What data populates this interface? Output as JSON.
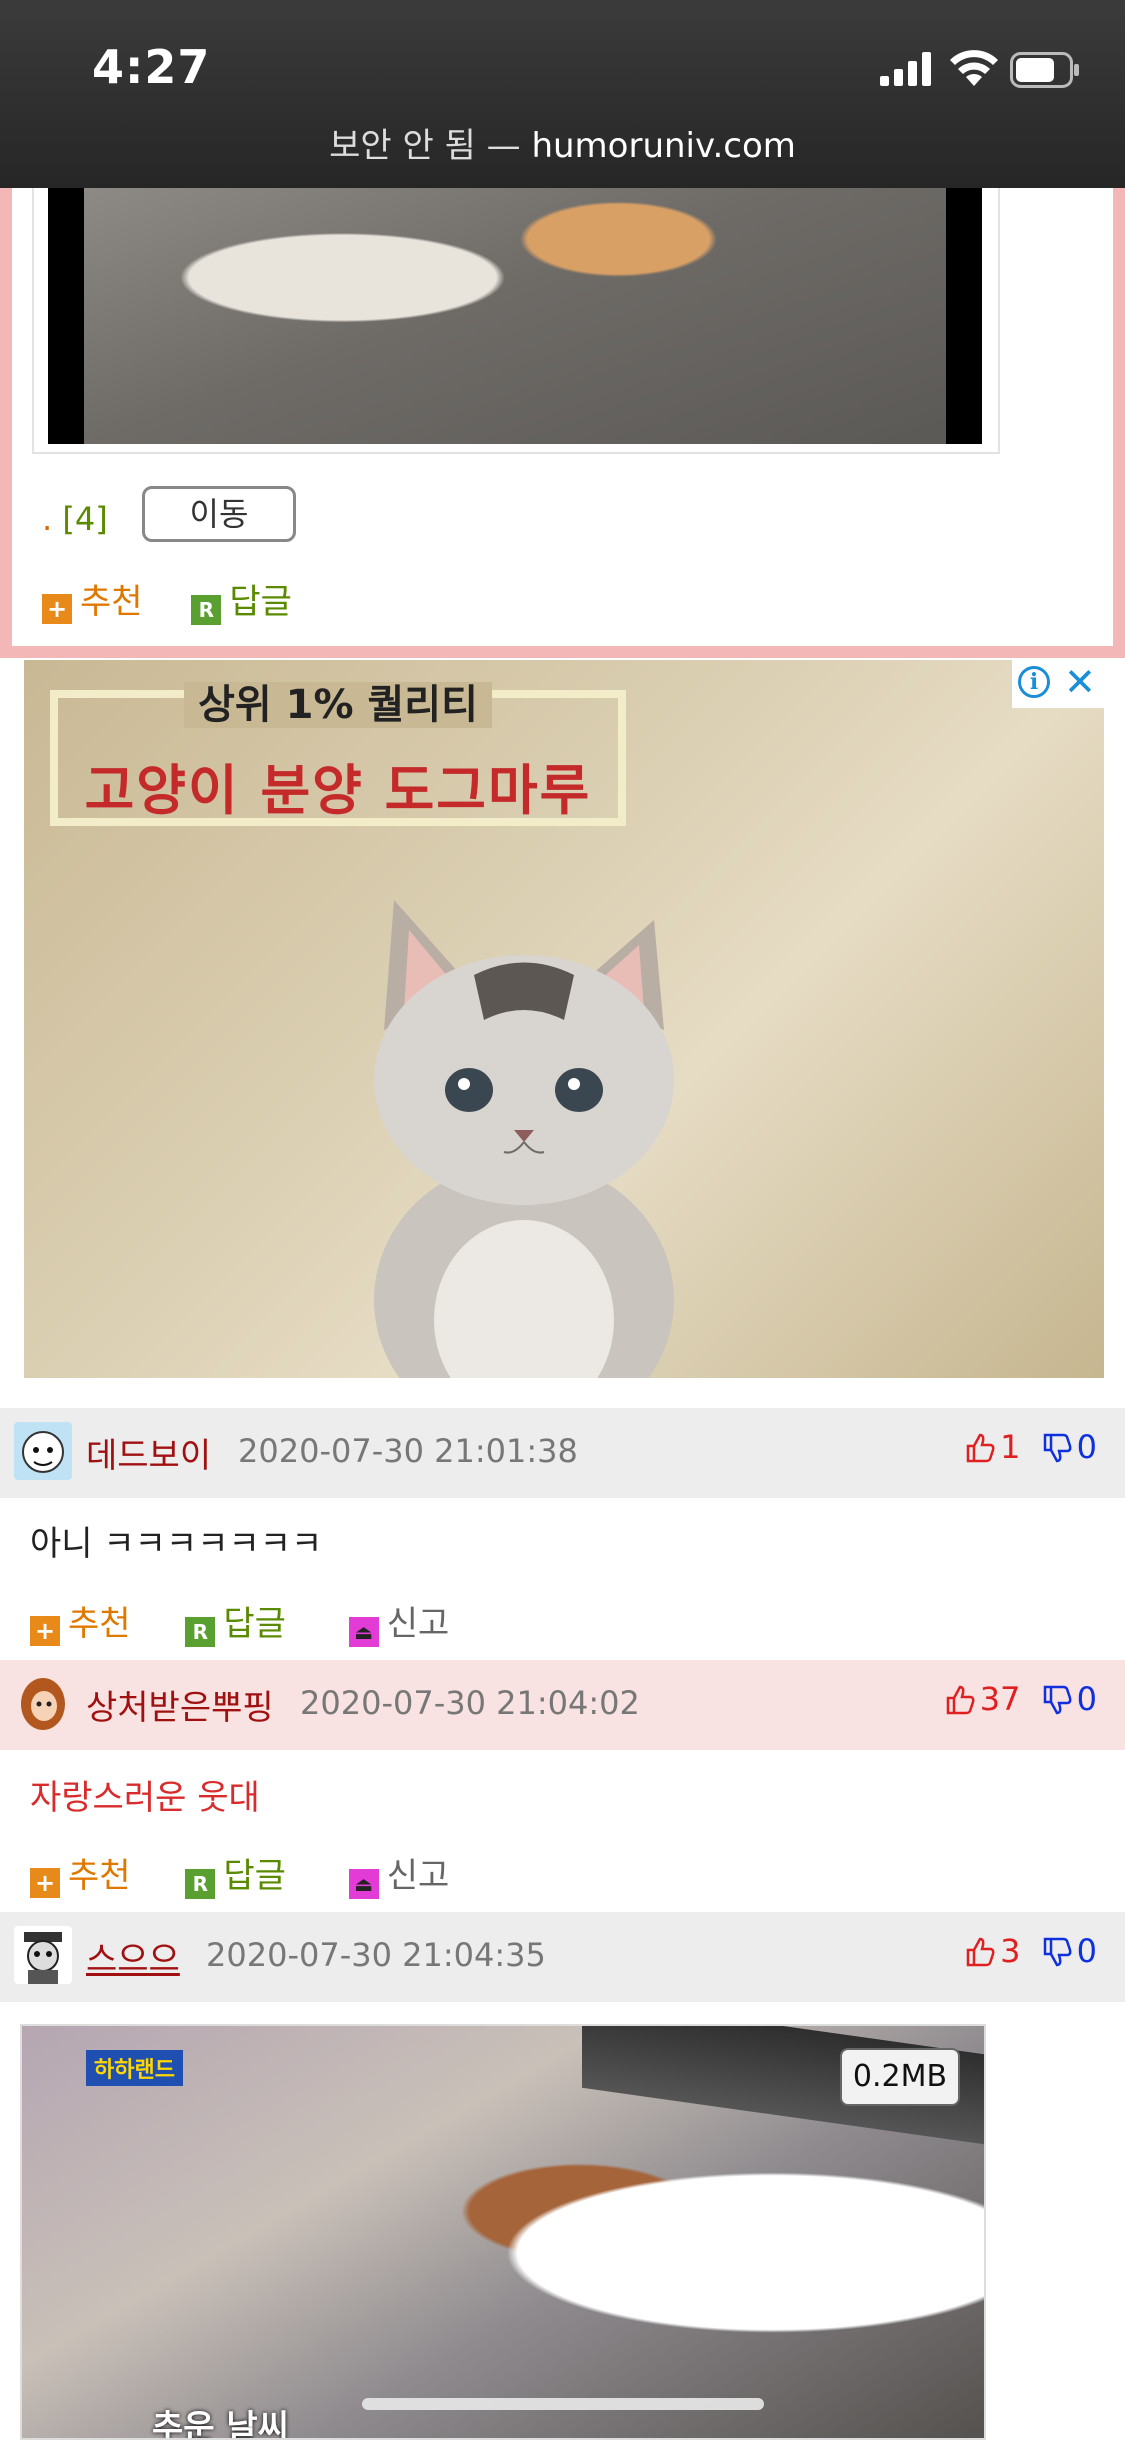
{
  "status": {
    "time": "4:27"
  },
  "browser": {
    "url_prefix": "보안 안 됨 —",
    "host": "humoruniv.com"
  },
  "post": {
    "page_dot": ".",
    "page_label": "[4]",
    "move_label": "이동",
    "recommend_label": "추천",
    "reply_label": "답글"
  },
  "ad": {
    "line1": "상위 1% 퀄리티",
    "line2": "고양이 분양 도그마루",
    "info_icon": "info-icon",
    "close_icon": "close-icon"
  },
  "comments": [
    {
      "author": "데드보이",
      "date": "2020-07-30 21:01:38",
      "up": "1",
      "down": "0",
      "text": "아니 ㅋㅋㅋㅋㅋㅋㅋ",
      "recommend_label": "추천",
      "reply_label": "답글",
      "report_label": "신고"
    },
    {
      "author": "상처받은뿌핑",
      "date": "2020-07-30 21:04:02",
      "up": "37",
      "down": "0",
      "text": "자랑스러운 웃대",
      "recommend_label": "추천",
      "reply_label": "답글",
      "report_label": "신고"
    },
    {
      "author": "스으으",
      "date": "2020-07-30 21:04:35",
      "up": "3",
      "down": "0",
      "image_size": "0.2MB",
      "image_caption": "추운 날씨",
      "image_logo": "하하랜드"
    }
  ],
  "colors": {
    "accent_frame": "#f4b7b7",
    "upvote": "#e02020",
    "downvote": "#1030e0",
    "recommend": "#e07800",
    "reply": "#5a8a00"
  }
}
